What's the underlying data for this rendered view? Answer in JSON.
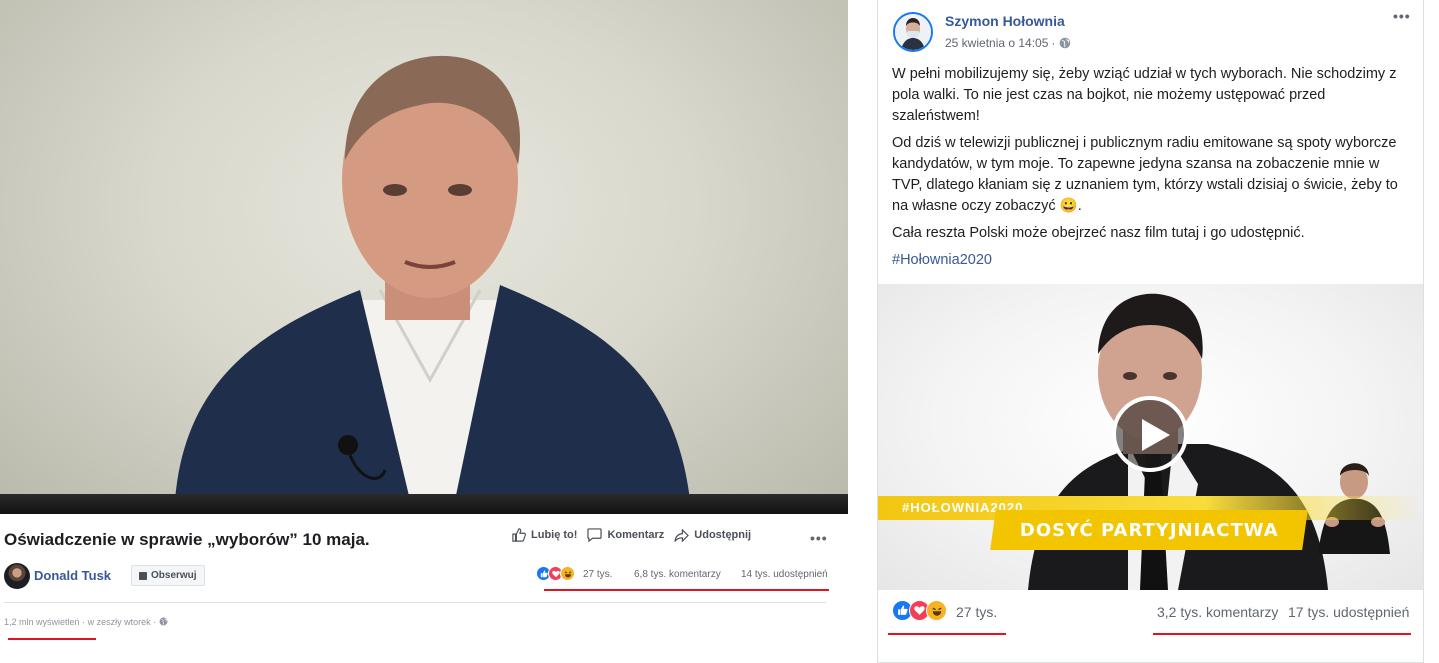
{
  "left_post": {
    "video_title": "Oświadczenie w sprawie „wyborów” 10 maja.",
    "actions": {
      "like": "Lubię to!",
      "comment": "Komentarz",
      "share": "Udostępnij"
    },
    "page_name": "Donald Tusk",
    "follow_label": "Obserwuj",
    "reactions_count": "27 tys.",
    "comments_count": "6,8 tys. komentarzy",
    "shares_count": "14 tys. udostępnień",
    "views": "1,2 mln wyświetleń",
    "time": "w zeszły wtorek",
    "separator": "·"
  },
  "right_post": {
    "author": "Szymon Hołownia",
    "timestamp": "25 kwietnia o 14:05",
    "separator": "·",
    "paragraphs": [
      "W pełni mobilizujemy się, żeby wziąć udział w tych wyborach. Nie schodzimy z pola walki. To nie jest czas na bojkot, nie możemy ustępować przed szaleństwem!",
      "Od dziś w telewizji publicznej i publicznym radiu emitowane są spoty wyborcze kandydatów, w tym moje. To zapewne jedyna szansa na zobaczenie mnie w TVP, dlatego kłaniam się z uznaniem tym, którzy wstali dzisiaj o świcie, żeby to na własne oczy zobaczyć 😀.",
      "Cała reszta Polski może obejrzeć nasz film tutaj i go udostępnić."
    ],
    "hashtag": "#Hołownia2020",
    "video_hashtag": "#HOŁOWNIA2020",
    "video_slogan": "DOSYĆ PARTYJNIACTWA",
    "reactions_count": "27 tys.",
    "comments_count": "3,2 tys. komentarzy",
    "shares_count": "17 tys. udostępnień"
  },
  "icons": [
    "like-icon",
    "comment-icon",
    "share-icon",
    "more-options-icon",
    "globe-icon",
    "play-icon",
    "reaction-like-icon",
    "reaction-love-icon",
    "reaction-haha-icon"
  ],
  "colors": {
    "link_blue": "#385898",
    "highlight_red": "#e0141e",
    "slogan_yellow": "#f3c500",
    "like_blue": "#1877f2",
    "love_red": "#f33e58",
    "haha_yellow": "#f7b125"
  }
}
